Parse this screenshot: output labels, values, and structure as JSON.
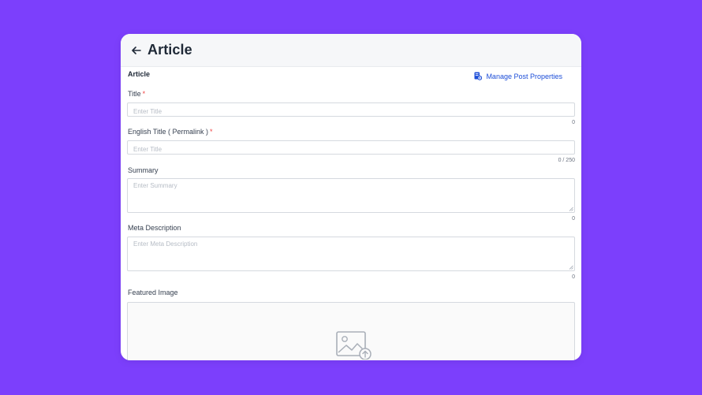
{
  "header": {
    "title": "Article"
  },
  "section": {
    "title": "Article",
    "manage_link": "Manage Post Properties"
  },
  "fields": {
    "title": {
      "label": "Title",
      "required": "*",
      "placeholder": "Enter Title",
      "value": "",
      "counter": "0"
    },
    "english_title": {
      "label": "English Title ( Permalink )",
      "required": "*",
      "placeholder": "Enter Title",
      "value": "",
      "counter": "0 / 250"
    },
    "summary": {
      "label": "Summary",
      "placeholder": "Enter Summary",
      "value": "",
      "counter": "0"
    },
    "meta_description": {
      "label": "Meta Description",
      "placeholder": "Enter Meta Description",
      "value": "",
      "counter": "0"
    },
    "featured_image": {
      "label": "Featured Image"
    }
  },
  "icons": {
    "back": "arrow-left-icon",
    "manage": "document-settings-icon",
    "upload": "image-upload-icon"
  },
  "colors": {
    "background": "#7c3ffc",
    "link": "#1d4ed8",
    "required": "#ef4444"
  }
}
